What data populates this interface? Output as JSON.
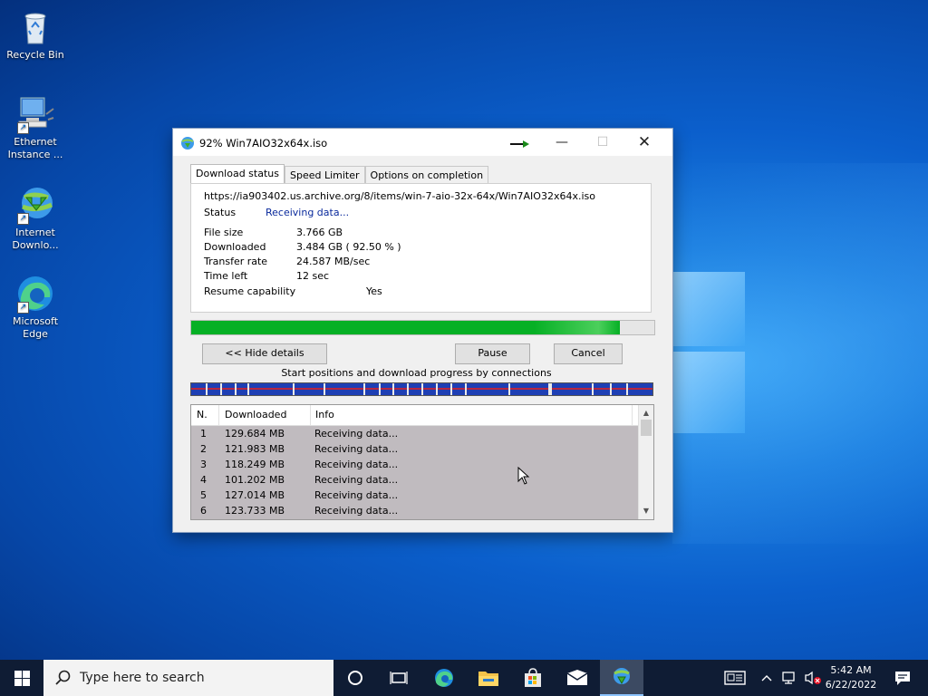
{
  "desktop": {
    "icons": [
      {
        "label": "Recycle Bin"
      },
      {
        "label": "Ethernet\nInstance ..."
      },
      {
        "label": "Internet\nDownlo..."
      },
      {
        "label": "Microsoft\nEdge"
      }
    ]
  },
  "window": {
    "title": "92% Win7AIO32x64x.iso",
    "tabs": [
      "Download status",
      "Speed Limiter",
      "Options on completion"
    ],
    "url": "https://ia903402.us.archive.org/8/items/win-7-aio-32x-64x/Win7AIO32x64x.iso",
    "status_label": "Status",
    "status_value": "Receiving data...",
    "fields": [
      {
        "label": "File size",
        "value": "3.766  GB"
      },
      {
        "label": "Downloaded",
        "value": "3.484  GB  ( 92.50 % )"
      },
      {
        "label": "Transfer rate",
        "value": "24.587  MB/sec"
      },
      {
        "label": "Time left",
        "value": "12 sec"
      }
    ],
    "resume_label": "Resume capability",
    "resume_value": "Yes",
    "progress_fraction": 0.925,
    "buttons": {
      "hide": "<< Hide details",
      "pause": "Pause",
      "cancel": "Cancel"
    },
    "connections_label": "Start positions and download progress by connections",
    "connections": {
      "columns": [
        "N.",
        "Downloaded",
        "Info"
      ],
      "rows": [
        {
          "n": "1",
          "downloaded": "129.684  MB",
          "info": "Receiving data..."
        },
        {
          "n": "2",
          "downloaded": "121.983  MB",
          "info": "Receiving data..."
        },
        {
          "n": "3",
          "downloaded": "118.249  MB",
          "info": "Receiving data..."
        },
        {
          "n": "4",
          "downloaded": "101.202  MB",
          "info": "Receiving data..."
        },
        {
          "n": "5",
          "downloaded": "127.014  MB",
          "info": "Receiving data..."
        },
        {
          "n": "6",
          "downloaded": "123.733  MB",
          "info": "Receiving data..."
        }
      ]
    }
  },
  "taskbar": {
    "search_placeholder": "Type here to search",
    "time": "5:42 AM",
    "date": "6/22/2022"
  },
  "colors": {
    "progress": "#06b025",
    "connection_bar": "#1e3fb4",
    "taskbar": "#0f1c34"
  }
}
